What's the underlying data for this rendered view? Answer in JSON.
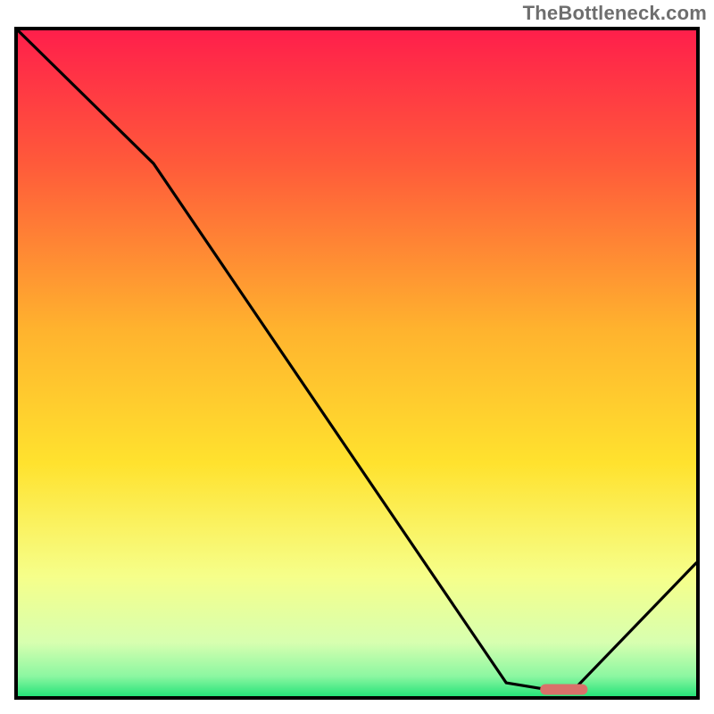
{
  "watermark": "TheBottleneck.com",
  "colors": {
    "border": "#000000",
    "watermark_text": "#6e6e6e",
    "curve": "#000000",
    "marker": "#d9716a",
    "gradient_stops": [
      {
        "offset": 0.0,
        "color": "#ff1f4b"
      },
      {
        "offset": 0.2,
        "color": "#ff5a3a"
      },
      {
        "offset": 0.45,
        "color": "#ffb32e"
      },
      {
        "offset": 0.65,
        "color": "#ffe22e"
      },
      {
        "offset": 0.82,
        "color": "#f6ff8a"
      },
      {
        "offset": 0.92,
        "color": "#d7ffb0"
      },
      {
        "offset": 0.97,
        "color": "#8cf7a1"
      },
      {
        "offset": 1.0,
        "color": "#27e37a"
      }
    ]
  },
  "chart_data": {
    "type": "line",
    "title": "",
    "xlabel": "",
    "ylabel": "",
    "xlim": [
      0,
      100
    ],
    "ylim": [
      0,
      100
    ],
    "grid": false,
    "series": [
      {
        "name": "bottleneck-curve",
        "x": [
          0,
          20,
          72,
          78,
          82,
          100
        ],
        "values": [
          100,
          80,
          2,
          1,
          1,
          20
        ]
      }
    ],
    "annotations": [
      {
        "name": "optimal-marker",
        "shape": "rounded-bar",
        "x_start": 77,
        "x_end": 84,
        "y": 1
      }
    ]
  }
}
